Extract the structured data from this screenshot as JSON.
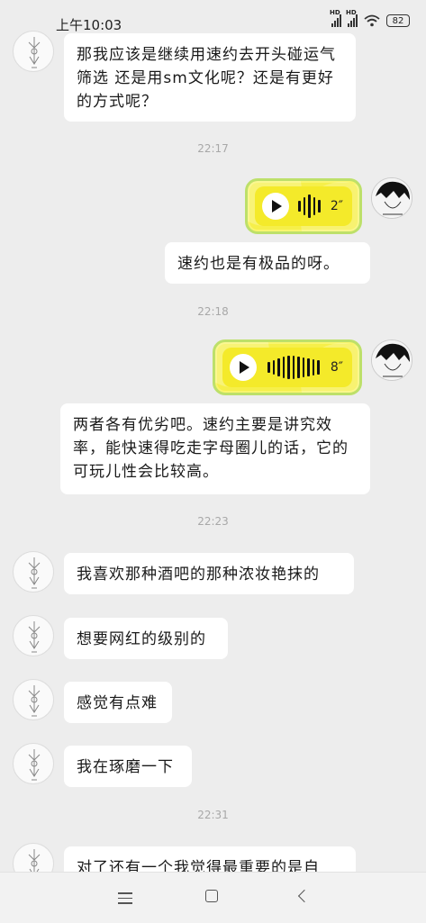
{
  "status_bar": {
    "time": "上午10:03",
    "signal1_label": "HD",
    "signal2_label": "HD",
    "battery": "82",
    "icons": [
      "signal-icon",
      "signal-icon",
      "wifi-icon",
      "battery-icon"
    ]
  },
  "messages": [
    {
      "type": "text",
      "side": "left",
      "text": "那我应该是继续用速约去开头碰运气筛选 还是用sm文化呢？还是有更好的方式呢？"
    },
    {
      "type": "time",
      "text": "22:17"
    },
    {
      "type": "voice",
      "side": "right",
      "duration": "2″"
    },
    {
      "type": "text",
      "side": "right",
      "text": "速约也是有极品的呀。"
    },
    {
      "type": "time",
      "text": "22:18"
    },
    {
      "type": "voice",
      "side": "right",
      "duration": "8″"
    },
    {
      "type": "text",
      "side": "right",
      "text": "两者各有优劣吧。速约主要是讲究效率，能快速得吃走字母圈儿的话，它的可玩儿性会比较高。"
    },
    {
      "type": "time",
      "text": "22:23"
    },
    {
      "type": "text",
      "side": "left",
      "text": "我喜欢那种酒吧的那种浓妆艳抹的"
    },
    {
      "type": "text",
      "side": "left",
      "text": "想要网红的级别的"
    },
    {
      "type": "text",
      "side": "left",
      "text": "感觉有点难"
    },
    {
      "type": "text",
      "side": "left",
      "text": "我在琢磨一下"
    },
    {
      "type": "time",
      "text": "22:31"
    },
    {
      "type": "text",
      "side": "left",
      "text": "对了还有一个我觉得最重要的是自"
    }
  ],
  "nav": {
    "icons": [
      "menu-icon",
      "home-icon",
      "back-icon"
    ]
  },
  "colors": {
    "background": "#ededed",
    "bubble": "#ffffff",
    "voice_bubble": "#f4ea2a",
    "voice_border": "#bde06a"
  }
}
